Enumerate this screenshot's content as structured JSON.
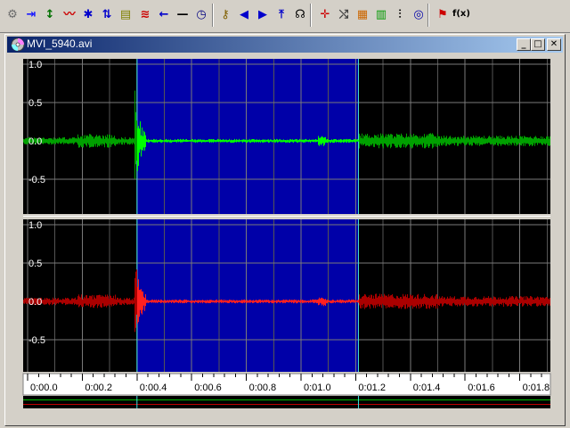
{
  "window": {
    "title": "MVI_5940.avi",
    "minimize_glyph": "_",
    "maximize_glyph": "□",
    "close_glyph": "✕"
  },
  "toolbar": {
    "buttons": [
      {
        "name": "settings-tool-icon",
        "glyph": "⚙",
        "color": "#6a6a6a"
      },
      {
        "name": "goto-end-icon",
        "glyph": "⇥",
        "color": "#1a1aff"
      },
      {
        "name": "vertical-zoom-icon",
        "glyph": "↕",
        "color": "#007000"
      },
      {
        "name": "wave-zoom-icon",
        "glyph": "〰",
        "color": "#cc0000"
      },
      {
        "name": "gear-icon",
        "glyph": "✱",
        "color": "#0000cc"
      },
      {
        "name": "swap-arrows-icon",
        "glyph": "⇅",
        "color": "#0000cc"
      },
      {
        "name": "spectrum-icon",
        "glyph": "▤",
        "color": "#808000"
      },
      {
        "name": "equalizer-icon",
        "glyph": "≋",
        "color": "#cc0000"
      },
      {
        "name": "arrow-left-icon",
        "glyph": "←",
        "color": "#0000cc"
      },
      {
        "name": "line-tool-icon",
        "glyph": "—",
        "color": "#000000"
      },
      {
        "name": "clock-icon",
        "glyph": "◷",
        "color": "#000080"
      },
      {
        "name": "key-find-icon",
        "glyph": "⚷",
        "color": "#806000"
      },
      {
        "name": "previous-marker-icon",
        "glyph": "◀",
        "color": "#0000cc"
      },
      {
        "name": "next-marker-icon",
        "glyph": "▶",
        "color": "#0000cc"
      },
      {
        "name": "crop-icon",
        "glyph": "⤒",
        "color": "#0000cc"
      },
      {
        "name": "auto-adjust-icon",
        "glyph": "☊",
        "color": "#000000"
      },
      {
        "name": "waveform-icon",
        "glyph": "✛",
        "color": "#cc0000"
      },
      {
        "name": "transform-icon",
        "glyph": "⤭",
        "color": "#404040"
      },
      {
        "name": "color-palette-icon",
        "glyph": "▦",
        "color": "#cc6600"
      },
      {
        "name": "color-grid-icon",
        "glyph": "▥",
        "color": "#009900"
      },
      {
        "name": "mixer-icon",
        "glyph": "⫶",
        "color": "#000000"
      },
      {
        "name": "display-icon",
        "glyph": "◎",
        "color": "#0000aa"
      },
      {
        "name": "marker-flag-icon",
        "glyph": "⚑",
        "color": "#cc0000"
      },
      {
        "name": "function-icon",
        "glyph": "f(x)",
        "color": "#000000"
      }
    ]
  },
  "waveform": {
    "y_ticks": [
      "1.0",
      "0.5",
      "0.0",
      "-0.5"
    ],
    "time_ticks": [
      "0:00.0",
      "0:00.2",
      "0:00.4",
      "0:00.6",
      "0:00.8",
      "0:01.0",
      "0:01.2",
      "0:01.4",
      "0:01.6",
      "0:01.8"
    ],
    "selection_start": 0.4,
    "selection_end": 1.21,
    "duration": 1.93,
    "channel1_color": "#00ff00",
    "channel1_dim_color": "#00a000",
    "channel2_color": "#ff2020",
    "channel2_dim_color": "#aa0000",
    "selection_color": "#0000a8",
    "background_color": "#000000"
  }
}
